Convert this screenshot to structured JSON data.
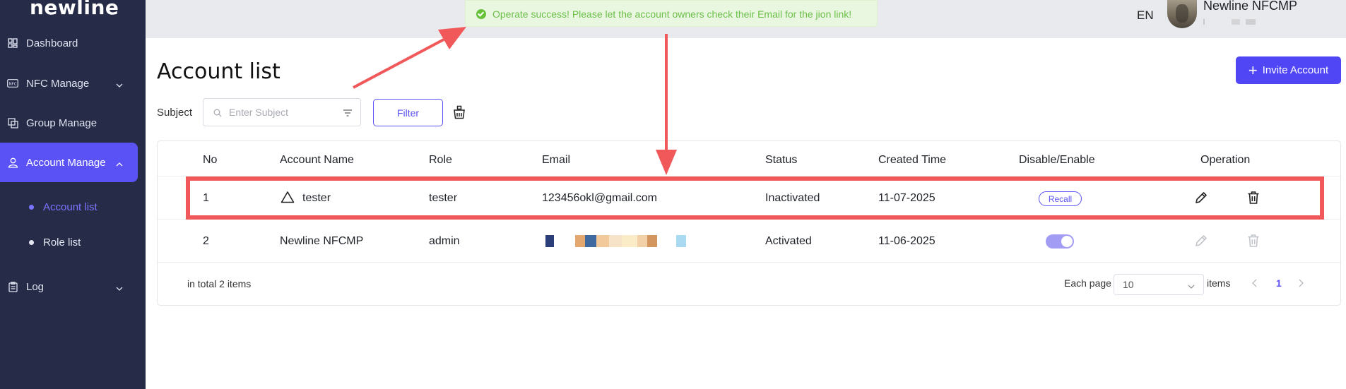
{
  "app": {
    "logo": "newline"
  },
  "sidebar": {
    "items": [
      {
        "label": "Dashboard",
        "icon": "dashboard-icon"
      },
      {
        "label": "NFC Manage",
        "icon": "nfc-icon"
      },
      {
        "label": "Group Manage",
        "icon": "group-icon"
      },
      {
        "label": "Account Manage",
        "icon": "user-icon",
        "active": true
      },
      {
        "label": "Log",
        "icon": "clipboard-icon"
      }
    ],
    "sub_items": [
      {
        "label": "Account list",
        "active": true
      },
      {
        "label": "Role list"
      }
    ]
  },
  "topbar": {
    "language": "EN",
    "user_name": "Newline NFCMP"
  },
  "toast": {
    "message": "Operate success! Please let the account owners check their Email for the jion link!",
    "type": "success"
  },
  "page": {
    "title": "Account list",
    "invite_label": "Invite Account"
  },
  "search": {
    "label": "Subject",
    "placeholder": "Enter Subject",
    "filter_label": "Filter"
  },
  "table": {
    "columns": [
      "No",
      "Account Name",
      "Role",
      "Email",
      "Status",
      "Created Time",
      "Disable/Enable",
      "Operation"
    ],
    "rows": [
      {
        "no": "1",
        "name": "tester",
        "role": "tester",
        "email": "123456okl@gmail.com",
        "status": "Inactivated",
        "created": "11-07-2025",
        "action": "Recall",
        "warning": true
      },
      {
        "no": "2",
        "name": "Newline NFCMP",
        "role": "admin",
        "email": "",
        "status": "Activated",
        "created": "11-06-2025",
        "enabled": true
      }
    ]
  },
  "pagination": {
    "total_text": "in total 2 items",
    "each_page_label": "Each page",
    "page_size": "10",
    "items_label": "items",
    "current_page": "1"
  },
  "colors": {
    "sidebar_bg": "#262b48",
    "accent": "#5a52f5",
    "toast_bg": "#e9f6e0",
    "toast_text": "#6cc04a",
    "annotation": "#f0585a"
  }
}
